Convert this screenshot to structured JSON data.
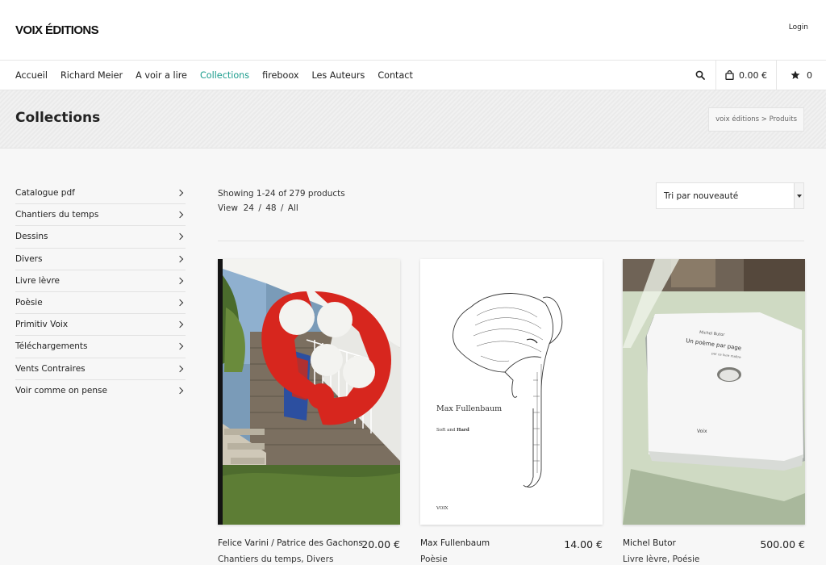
{
  "brand": {
    "logo": "VOIX ÉDITIONS",
    "login": "Login"
  },
  "nav": {
    "items": [
      {
        "label": "Accueil"
      },
      {
        "label": "Richard Meier"
      },
      {
        "label": "A voir a lire"
      },
      {
        "label": "Collections",
        "active": true
      },
      {
        "label": "fireboox"
      },
      {
        "label": "Les Auteurs"
      },
      {
        "label": "Contact"
      }
    ],
    "cart_total": "0.00 €",
    "favorites_count": "0",
    "icons": {
      "search": "search-icon",
      "cart": "shopping-bag-icon",
      "favorites": "star-icon"
    }
  },
  "page": {
    "title": "Collections",
    "breadcrumb": "voix éditions > Produits"
  },
  "sidebar": {
    "categories": [
      {
        "label": "Catalogue pdf"
      },
      {
        "label": "Chantiers du temps"
      },
      {
        "label": "Dessins"
      },
      {
        "label": "Divers"
      },
      {
        "label": "Livre lèvre"
      },
      {
        "label": "Poèsie"
      },
      {
        "label": "Primitiv Voix"
      },
      {
        "label": "Téléchargements"
      },
      {
        "label": "Vents Contraires"
      },
      {
        "label": "Voir comme on pense"
      }
    ]
  },
  "listing": {
    "showing": "Showing 1-24 of 279 products",
    "view_label": "View",
    "view_options": [
      "24",
      "48",
      "All"
    ],
    "sort_selected": "Tri par nouveauté"
  },
  "products": [
    {
      "name": "Felice Varini / Patrice des Gachons",
      "price": "20.00 €",
      "categories": "Chantiers du temps, Divers"
    },
    {
      "name": "Max Fullenbaum",
      "price": "14.00 €",
      "categories": "Poèsie",
      "cover_author": "Max Fullenbaum",
      "cover_subtitle_a": "Soft and ",
      "cover_subtitle_b": "Hard",
      "cover_publisher": "VOIX"
    },
    {
      "name": "Michel Butor",
      "price": "500.00 €",
      "categories": "Livre lèvre, Poésie",
      "cover_header": "Michel Butor",
      "cover_title": "Un poème par page",
      "cover_sub": "par ce livre maître",
      "cover_publisher": "Voix"
    }
  ],
  "colors": {
    "accent": "#1a9c8c",
    "text": "#222222",
    "background": "#f7f7f7"
  }
}
